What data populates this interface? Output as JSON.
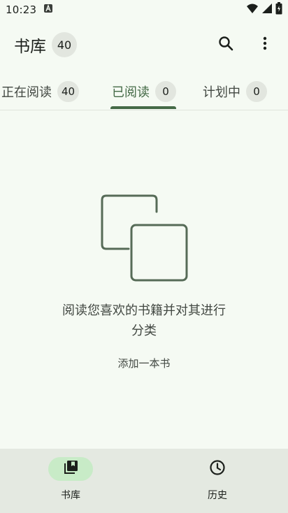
{
  "status_bar": {
    "time": "10:23",
    "icons": [
      "notification-a-icon",
      "wifi-icon",
      "signal-icon",
      "battery-icon"
    ]
  },
  "app_bar": {
    "title": "书库",
    "count": "40",
    "actions": [
      "search-icon",
      "more-vert-icon"
    ]
  },
  "tabs": [
    {
      "label": "正在阅读",
      "count": "40",
      "active": false
    },
    {
      "label": "已阅读",
      "count": "0",
      "active": true
    },
    {
      "label": "计划中",
      "count": "0",
      "active": false
    }
  ],
  "empty_state": {
    "message": "阅读您喜欢的书籍并对其进行分类",
    "action_label": "添加一本书",
    "icon": "copy-icon"
  },
  "bottom_nav": {
    "items": [
      {
        "label": "书库",
        "icon": "library-books-icon",
        "active": true
      },
      {
        "label": "历史",
        "icon": "history-clock-icon",
        "active": false
      }
    ]
  },
  "colors": {
    "background": "#f5faf3",
    "primary": "#446a46",
    "pill": "#e2e6df",
    "nav_background": "#e4e9e1",
    "nav_active": "#c8ebc7"
  }
}
